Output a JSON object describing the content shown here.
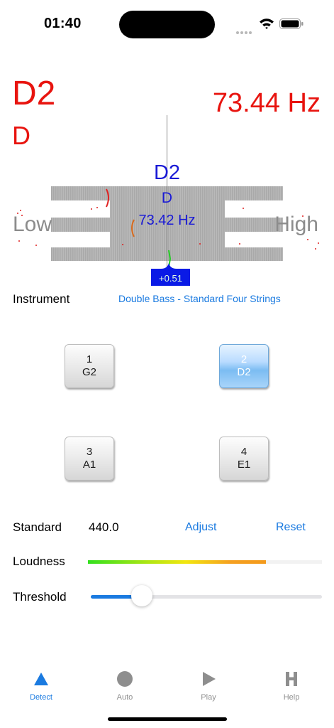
{
  "status_bar": {
    "time": "01:40"
  },
  "detected": {
    "note": "D2",
    "name": "D",
    "frequency": "73.44 Hz"
  },
  "target": {
    "note": "D2",
    "name": "D",
    "frequency": "73.42 Hz",
    "cents": "+0.51"
  },
  "gauge": {
    "low_label": "Low",
    "high_label": "High"
  },
  "instrument": {
    "label": "Instrument",
    "value": "Double Bass - Standard Four Strings"
  },
  "strings": [
    {
      "number": "1",
      "note": "G2",
      "selected": false
    },
    {
      "number": "2",
      "note": "D2",
      "selected": true
    },
    {
      "number": "3",
      "note": "A1",
      "selected": false
    },
    {
      "number": "4",
      "note": "E1",
      "selected": false
    }
  ],
  "standard": {
    "label": "Standard",
    "value": "440.0",
    "adjust_label": "Adjust",
    "reset_label": "Reset"
  },
  "loudness": {
    "label": "Loudness",
    "level": 0.76
  },
  "threshold": {
    "label": "Threshold",
    "level": 0.22
  },
  "tabs": [
    {
      "label": "Detect",
      "icon": "triangle-icon",
      "active": true
    },
    {
      "label": "Auto",
      "icon": "circle-icon",
      "active": false
    },
    {
      "label": "Play",
      "icon": "play-icon",
      "active": false
    },
    {
      "label": "Help",
      "icon": "h-icon",
      "active": false
    }
  ],
  "colors": {
    "accent": "#1a7ae0",
    "detected": "#e8140f",
    "target": "#1a1ad6",
    "cents_badge": "#0a1ae6"
  }
}
